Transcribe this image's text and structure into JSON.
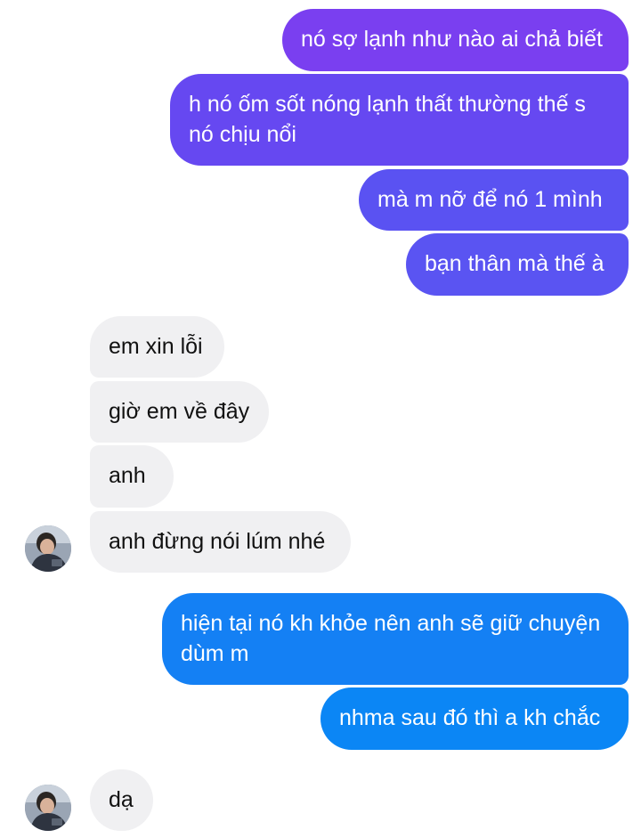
{
  "conversation": {
    "messages": [
      {
        "direction": "sent",
        "lines": [
          "nó sợ lạnh như nào ai chả biết"
        ]
      },
      {
        "direction": "sent",
        "lines": [
          "h nó ốm sốt nóng lạnh thất thường thế s",
          "nó chịu nổi"
        ]
      },
      {
        "direction": "sent",
        "lines": [
          "mà m nỡ để nó 1 mình"
        ]
      },
      {
        "direction": "sent",
        "lines": [
          "bạn thân mà thế à"
        ]
      },
      {
        "direction": "received",
        "lines": [
          "em xin lỗi"
        ]
      },
      {
        "direction": "received",
        "lines": [
          "giờ em về đây"
        ]
      },
      {
        "direction": "received",
        "lines": [
          "anh"
        ]
      },
      {
        "direction": "received",
        "lines": [
          "anh đừng nói lúm nhé"
        ]
      },
      {
        "direction": "sent",
        "lines": [
          "hiện tại nó kh khỏe nên anh sẽ giữ chuyện",
          "dùm m"
        ]
      },
      {
        "direction": "sent",
        "lines": [
          "nhma sau đó thì a kh chắc"
        ]
      },
      {
        "direction": "received",
        "lines": [
          "dạ"
        ]
      }
    ]
  },
  "avatars": [
    {
      "icon": "contact-avatar-icon"
    },
    {
      "icon": "contact-avatar-icon"
    }
  ],
  "colors": {
    "sent_gradient_top": "#7a3ff0",
    "sent_gradient_bottom": "#0b86f5",
    "received_bg": "#f0f0f2",
    "received_text": "#111111",
    "sent_text": "#ffffff"
  }
}
